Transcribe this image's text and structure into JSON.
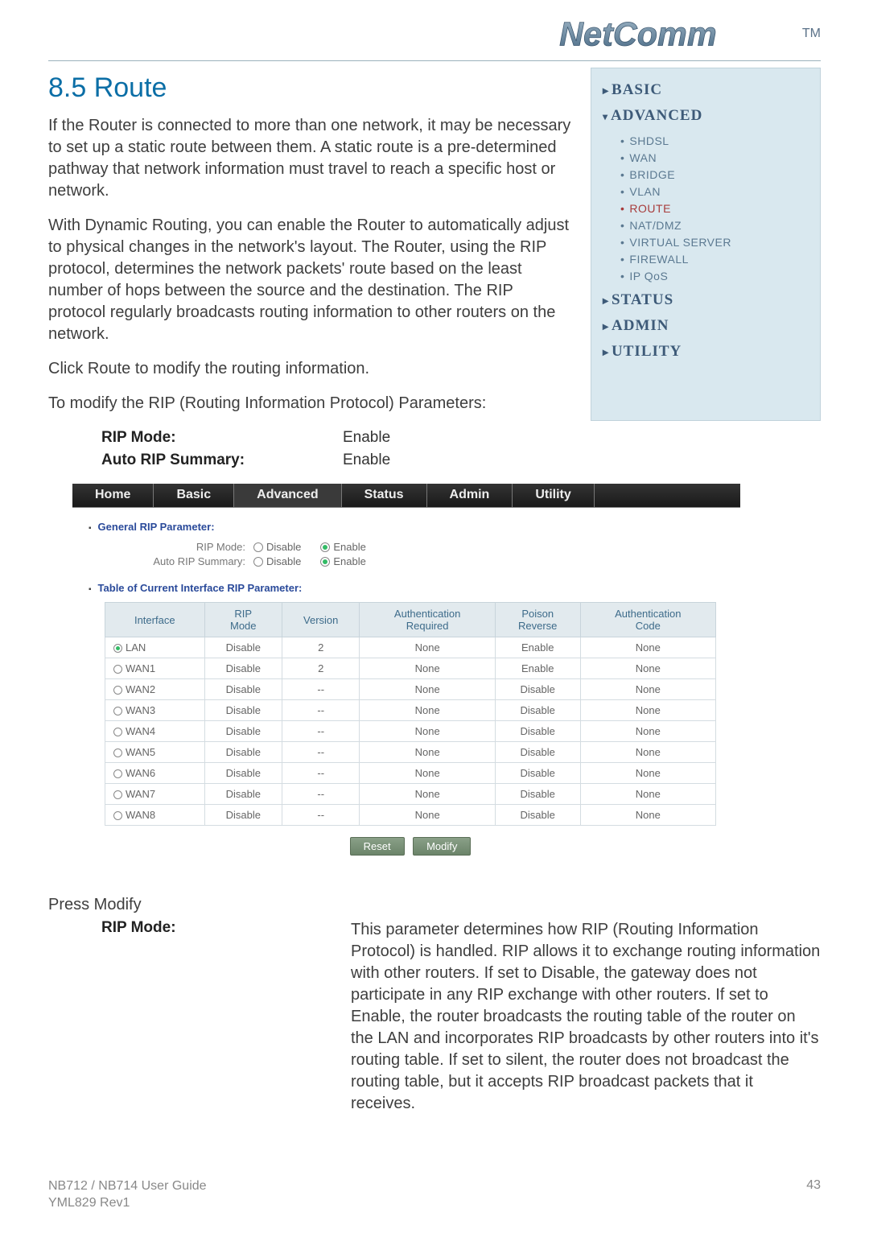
{
  "brand": {
    "name": "NetComm",
    "tm": "TM"
  },
  "section": {
    "number": "8.5",
    "title": "Route"
  },
  "paragraphs": {
    "p1": "If the Router is connected to more than one network, it may be necessary to set up a static route between them. A static route is a pre-determined pathway that network information must travel to reach a specific host or network.",
    "p2": "With Dynamic Routing, you can enable the Router to automatically adjust to physical changes in the network's layout. The Router, using the RIP protocol, determines the network packets' route based on the least number of hops between the source and the destination. The RIP protocol regularly broadcasts routing information to other routers on the network.",
    "p3": "Click Route to modify the routing information.",
    "p4": "To modify the RIP (Routing Information Protocol) Parameters:"
  },
  "sidebar": {
    "items": [
      {
        "label": "BASIC",
        "expanded": false
      },
      {
        "label": "ADVANCED",
        "expanded": true
      },
      {
        "label": "STATUS",
        "expanded": false
      },
      {
        "label": "ADMIN",
        "expanded": false
      },
      {
        "label": "UTILITY",
        "expanded": false
      }
    ],
    "advanced_sub": [
      "SHDSL",
      "WAN",
      "BRIDGE",
      "VLAN",
      "ROUTE",
      "NAT/DMZ",
      "VIRTUAL SERVER",
      "FIREWALL",
      "IP QoS"
    ],
    "active_sub": "ROUTE"
  },
  "rip_params_inline": {
    "rows": [
      {
        "label": "RIP Mode:",
        "value": "Enable"
      },
      {
        "label": "Auto RIP Summary:",
        "value": "Enable"
      }
    ]
  },
  "tabbar": [
    "Home",
    "Basic",
    "Advanced",
    "Status",
    "Admin",
    "Utility"
  ],
  "rip_panel": {
    "general_heading": "General RIP Parameter:",
    "table_heading": "Table of Current Interface RIP Parameter:",
    "general_rows": [
      {
        "label": "RIP Mode:",
        "options": [
          "Disable",
          "Enable"
        ],
        "selected": "Enable"
      },
      {
        "label": "Auto RIP Summary:",
        "options": [
          "Disable",
          "Enable"
        ],
        "selected": "Enable"
      }
    ],
    "columns": [
      "Interface",
      "RIP Mode",
      "Version",
      "Authentication Required",
      "Poison Reverse",
      "Authentication Code"
    ],
    "rows": [
      {
        "iface": "LAN",
        "selected": true,
        "mode": "Disable",
        "version": "2",
        "auth_req": "None",
        "poison": "Enable",
        "auth_code": "None"
      },
      {
        "iface": "WAN1",
        "selected": false,
        "mode": "Disable",
        "version": "2",
        "auth_req": "None",
        "poison": "Enable",
        "auth_code": "None"
      },
      {
        "iface": "WAN2",
        "selected": false,
        "mode": "Disable",
        "version": "--",
        "auth_req": "None",
        "poison": "Disable",
        "auth_code": "None"
      },
      {
        "iface": "WAN3",
        "selected": false,
        "mode": "Disable",
        "version": "--",
        "auth_req": "None",
        "poison": "Disable",
        "auth_code": "None"
      },
      {
        "iface": "WAN4",
        "selected": false,
        "mode": "Disable",
        "version": "--",
        "auth_req": "None",
        "poison": "Disable",
        "auth_code": "None"
      },
      {
        "iface": "WAN5",
        "selected": false,
        "mode": "Disable",
        "version": "--",
        "auth_req": "None",
        "poison": "Disable",
        "auth_code": "None"
      },
      {
        "iface": "WAN6",
        "selected": false,
        "mode": "Disable",
        "version": "--",
        "auth_req": "None",
        "poison": "Disable",
        "auth_code": "None"
      },
      {
        "iface": "WAN7",
        "selected": false,
        "mode": "Disable",
        "version": "--",
        "auth_req": "None",
        "poison": "Disable",
        "auth_code": "None"
      },
      {
        "iface": "WAN8",
        "selected": false,
        "mode": "Disable",
        "version": "--",
        "auth_req": "None",
        "poison": "Disable",
        "auth_code": "None"
      }
    ],
    "buttons": {
      "reset": "Reset",
      "modify": "Modify"
    }
  },
  "press_modify": "Press Modify",
  "desc": {
    "label": "RIP Mode:",
    "body": "This parameter determines how RIP (Routing Information Protocol) is handled. RIP allows it to exchange routing information with other routers. If set to Disable, the gateway does not participate in any RIP exchange with other routers. If set to Enable, the router broadcasts the routing table of the router on the LAN and incorporates RIP broadcasts by other routers into it's routing table. If set to silent, the router does not broadcast the routing table, but it accepts RIP broadcast packets that it receives."
  },
  "footer": {
    "left1": "NB712 / NB714 User Guide",
    "left2": "YML829 Rev1",
    "right": "43"
  }
}
